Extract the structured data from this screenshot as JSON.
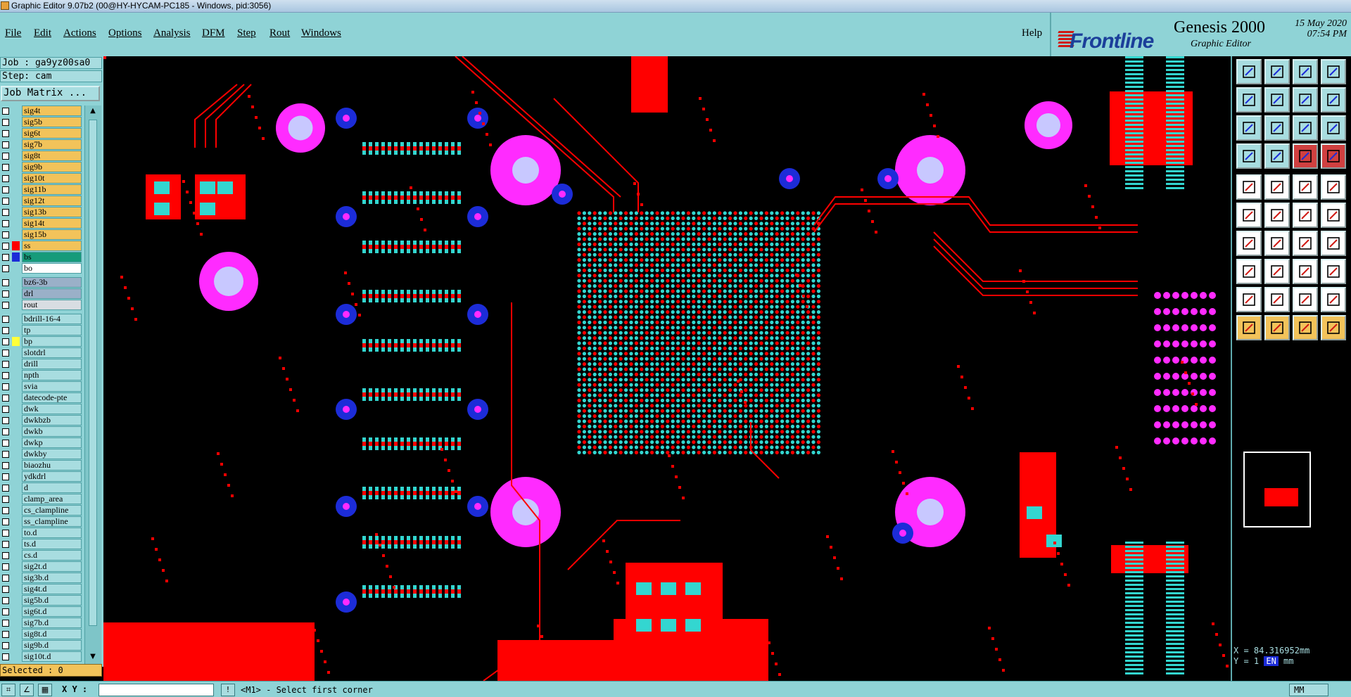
{
  "window": {
    "title": "Graphic Editor 9.07b2 (00@HY-HYCAM-PC185 - Windows, pid:3056)"
  },
  "menu": {
    "items": [
      "File",
      "Edit",
      "Actions",
      "Options",
      "Analysis",
      "DFM",
      "Step",
      "Rout",
      "Windows"
    ],
    "help": "Help"
  },
  "branding": {
    "logo": "Frontline",
    "product": "Genesis 2000",
    "subtitle": "Graphic Editor",
    "date": "15 May 2020",
    "time": "07:54 PM"
  },
  "job": {
    "job_line": "Job : ga9yz00sa0",
    "step_line": "Step: cam",
    "matrix_button": "Job Matrix ..."
  },
  "layers": [
    {
      "name": "sig4t",
      "color": "#f2c35a",
      "swatch": ""
    },
    {
      "name": "sig5b",
      "color": "#f2c35a",
      "swatch": ""
    },
    {
      "name": "sig6t",
      "color": "#f2c35a",
      "swatch": ""
    },
    {
      "name": "sig7b",
      "color": "#f2c35a",
      "swatch": ""
    },
    {
      "name": "sig8t",
      "color": "#f2c35a",
      "swatch": ""
    },
    {
      "name": "sig9b",
      "color": "#f2c35a",
      "swatch": ""
    },
    {
      "name": "sig10t",
      "color": "#f2c35a",
      "swatch": ""
    },
    {
      "name": "sig11b",
      "color": "#f2c35a",
      "swatch": ""
    },
    {
      "name": "sig12t",
      "color": "#f2c35a",
      "swatch": ""
    },
    {
      "name": "sig13b",
      "color": "#f2c35a",
      "swatch": ""
    },
    {
      "name": "sig14t",
      "color": "#f2c35a",
      "swatch": ""
    },
    {
      "name": "sig15b",
      "color": "#f2c35a",
      "swatch": ""
    },
    {
      "name": "ss",
      "color": "#f2c35a",
      "swatch": "#ff0000"
    },
    {
      "name": "bs",
      "color": "#169b7a",
      "swatch": "#1c2cd8"
    },
    {
      "name": "bo",
      "color": "#ffffff",
      "swatch": ""
    },
    {
      "name": "bz6-3b",
      "color": "#9ab0c8",
      "swatch": ""
    },
    {
      "name": "drl",
      "color": "#9ab0c8",
      "swatch": ""
    },
    {
      "name": "rout",
      "color": "#d8dde2",
      "swatch": ""
    },
    {
      "name": "bdrill-16-4",
      "color": "#a8dde0",
      "swatch": ""
    },
    {
      "name": "tp",
      "color": "#a8dde0",
      "swatch": ""
    },
    {
      "name": "bp",
      "color": "#a8dde0",
      "swatch": "#ffff3a"
    },
    {
      "name": "slotdrl",
      "color": "#a8dde0",
      "swatch": ""
    },
    {
      "name": "drill",
      "color": "#a8dde0",
      "swatch": ""
    },
    {
      "name": "npth",
      "color": "#a8dde0",
      "swatch": ""
    },
    {
      "name": "svia",
      "color": "#a8dde0",
      "swatch": ""
    },
    {
      "name": "datecode-pte",
      "color": "#a8dde0",
      "swatch": ""
    },
    {
      "name": "dwk",
      "color": "#a8dde0",
      "swatch": ""
    },
    {
      "name": "dwkbzb",
      "color": "#a8dde0",
      "swatch": ""
    },
    {
      "name": "dwkb",
      "color": "#a8dde0",
      "swatch": ""
    },
    {
      "name": "dwkp",
      "color": "#a8dde0",
      "swatch": ""
    },
    {
      "name": "dwkby",
      "color": "#a8dde0",
      "swatch": ""
    },
    {
      "name": "biaozhu",
      "color": "#a8dde0",
      "swatch": ""
    },
    {
      "name": "ydkdrl",
      "color": "#a8dde0",
      "swatch": ""
    },
    {
      "name": "d",
      "color": "#a8dde0",
      "swatch": ""
    },
    {
      "name": "clamp_area",
      "color": "#a8dde0",
      "swatch": ""
    },
    {
      "name": "cs_clampline",
      "color": "#a8dde0",
      "swatch": ""
    },
    {
      "name": "ss_clampline",
      "color": "#a8dde0",
      "swatch": ""
    },
    {
      "name": "to.d",
      "color": "#a8dde0",
      "swatch": ""
    },
    {
      "name": "ts.d",
      "color": "#a8dde0",
      "swatch": ""
    },
    {
      "name": "cs.d",
      "color": "#a8dde0",
      "swatch": ""
    },
    {
      "name": "sig2t.d",
      "color": "#a8dde0",
      "swatch": ""
    },
    {
      "name": "sig3b.d",
      "color": "#a8dde0",
      "swatch": ""
    },
    {
      "name": "sig4t.d",
      "color": "#a8dde0",
      "swatch": ""
    },
    {
      "name": "sig5b.d",
      "color": "#a8dde0",
      "swatch": ""
    },
    {
      "name": "sig6t.d",
      "color": "#a8dde0",
      "swatch": ""
    },
    {
      "name": "sig7b.d",
      "color": "#a8dde0",
      "swatch": ""
    },
    {
      "name": "sig8t.d",
      "color": "#a8dde0",
      "swatch": ""
    },
    {
      "name": "sig9b.d",
      "color": "#a8dde0",
      "swatch": ""
    },
    {
      "name": "sig10t.d",
      "color": "#a8dde0",
      "swatch": ""
    }
  ],
  "status": {
    "selected": "Selected : 0",
    "xy_label": "X Y :",
    "xy_value": "",
    "prompt": "<M1> - Select first corner",
    "units": "MM",
    "coord_x": "X = 84.316952mm",
    "coord_y": "Y = 1",
    "coord_y_unit": "mm"
  },
  "colors": {
    "panel": "#8fd3d6",
    "trace": "#ff0000",
    "pad": "#33d6d0",
    "via": "#ff2bff",
    "blue_via": "#1c2cd8",
    "canvas": "#000000"
  },
  "toolbox": [
    "zoom-home-icon",
    "zoom-pan-icon",
    "zoom-house-icon",
    "zoom-grid-icon",
    "fit-left-icon",
    "fit-right-icon",
    "fit-screen-icon",
    "mirror-icon",
    "zoom-frame-icon",
    "zoom-move-icon",
    "zoom-ratio-icon",
    "help-query-icon",
    "snap-icon",
    "measure-icon",
    "layer-icon",
    "layer-stack-icon",
    "select-pad-icon",
    "select-area-icon",
    "ruler-icon",
    "stop-icon",
    "net-icon",
    "cross-icon",
    "add-line-icon",
    "connect-icon",
    "line-draw-icon",
    "line-edit-icon",
    "arc-icon",
    "fill-icon",
    "dim-icon",
    "trace-icon",
    "place-icon",
    "array-icon",
    "triangle-icon",
    "triangle-alt-icon",
    "triangle-a-icon",
    "triangle-b-icon",
    "cursor-icon",
    "cursor-alt-icon",
    "cursor-drag-icon",
    "route-icon"
  ]
}
